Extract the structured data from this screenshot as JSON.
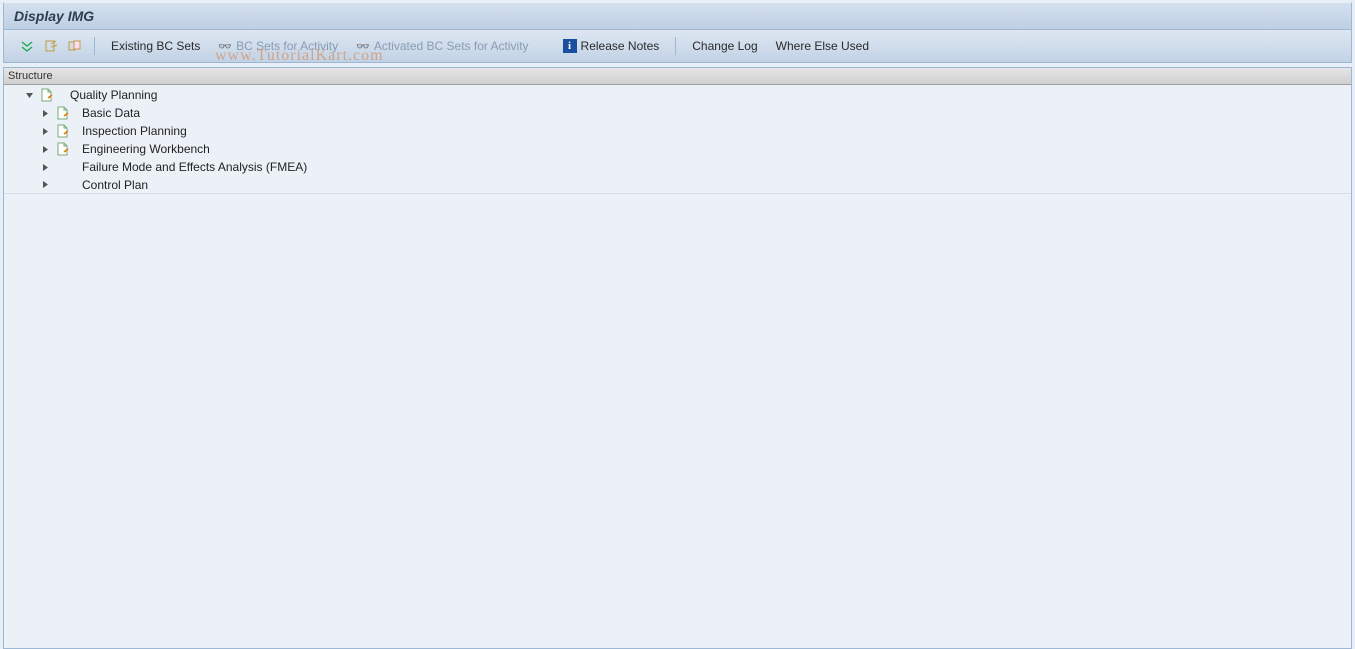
{
  "title": "Display IMG",
  "toolbar": {
    "existing_bc_sets": "Existing BC Sets",
    "bc_sets_for_activity": "BC Sets for Activity",
    "activated_bc_sets": "Activated BC Sets for Activity",
    "release_notes": "Release Notes",
    "change_log": "Change Log",
    "where_else_used": "Where Else Used"
  },
  "structure_header": "Structure",
  "tree": {
    "root": "Quality Planning",
    "children": [
      {
        "label": "Basic Data",
        "has_doc": true
      },
      {
        "label": "Inspection Planning",
        "has_doc": true
      },
      {
        "label": "Engineering Workbench",
        "has_doc": true
      },
      {
        "label": "Failure Mode and Effects Analysis (FMEA)",
        "has_doc": false
      },
      {
        "label": "Control Plan",
        "has_doc": false
      }
    ]
  },
  "watermark": "www.TutorialKart.com"
}
